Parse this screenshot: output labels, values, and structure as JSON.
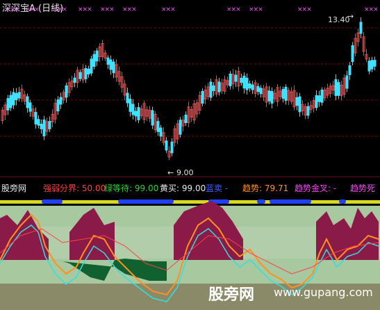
{
  "header": {
    "title": "深深宝A (日线)"
  },
  "markers": {
    "x_glyph": "×××"
  },
  "upper_chart": {
    "high_label": "13.40",
    "low_label": "9.00"
  },
  "indicator_bar": {
    "panel_name": "股旁网",
    "items": [
      {
        "label": "强弱分界: 50.00",
        "color": "#ff4040"
      },
      {
        "label": "绿等待: 99.00",
        "color": "#30d030"
      },
      {
        "label": "黄买: 99.00",
        "color": "#e8e8e8"
      },
      {
        "label": "蓝卖 -",
        "color": "#4060ff"
      },
      {
        "label": "趋势: 79.71",
        "color": "#ff9030"
      },
      {
        "label": "趋势金叉: -",
        "color": "#ff40ff"
      },
      {
        "label": "趋势死",
        "color": "#ff40ff"
      }
    ]
  },
  "watermark": {
    "text": "股旁网",
    "url": "www.gupang.com"
  },
  "colors": {
    "up_candle": "#ff4040",
    "down_candle": "#40e0ff",
    "maroon_fill": "#8a1a48",
    "light_green_band": "#a8c8a0",
    "dark_green_fill": "#106030",
    "orange_line": "#ff9020",
    "cyan_line": "#30e0e0"
  }
}
